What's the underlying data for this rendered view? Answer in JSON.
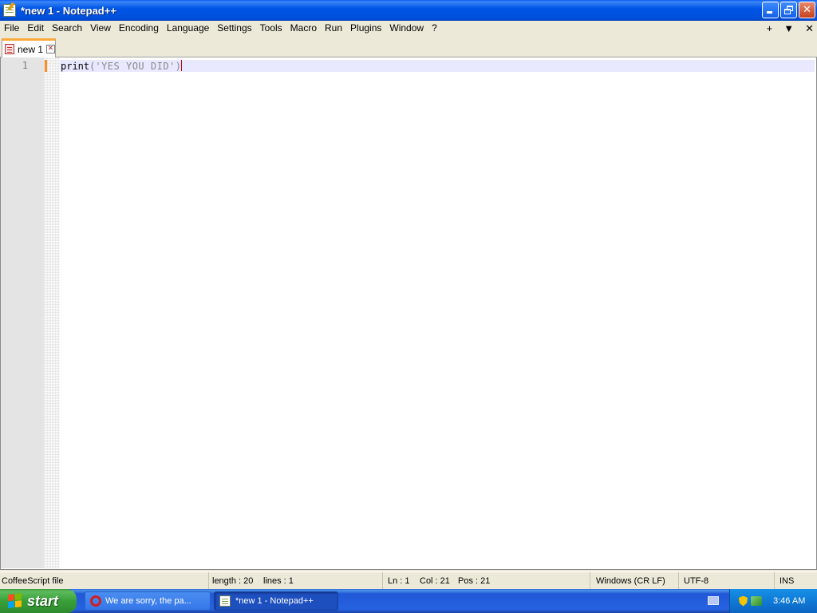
{
  "window": {
    "title": "*new 1 - Notepad++",
    "minimize_glyph": "_",
    "close_glyph": "✕"
  },
  "menu": {
    "items": [
      "File",
      "Edit",
      "Search",
      "View",
      "Encoding",
      "Language",
      "Settings",
      "Tools",
      "Macro",
      "Run",
      "Plugins",
      "Window",
      "?"
    ],
    "right": {
      "add": "+",
      "dropdown": "▼",
      "close": "✕"
    }
  },
  "tabs": [
    {
      "label": "new 1",
      "close": "✕",
      "modified": true
    }
  ],
  "editor": {
    "line_numbers": [
      "1"
    ],
    "code": {
      "fn": "print",
      "open": "(",
      "string": "'YES YOU DID'",
      "close": ")"
    }
  },
  "status": {
    "file_type": "CoffeeScript file",
    "length": "length : 20",
    "lines": "lines : 1",
    "ln": "Ln : 1",
    "col": "Col : 21",
    "pos": "Pos : 21",
    "eol": "Windows (CR LF)",
    "encoding": "UTF-8",
    "mode": "INS"
  },
  "taskbar": {
    "start_label": "start",
    "buttons": [
      {
        "label": "We are sorry, the pa...",
        "icon": "opera-icon",
        "active": false
      },
      {
        "label": "*new 1 - Notepad++",
        "icon": "notepad-icon",
        "active": true
      }
    ],
    "clock": "3:46 AM"
  },
  "colors": {
    "title_bar": "#0055E5",
    "tab_accent": "#FAAA3C",
    "current_line": "#E8E8FF",
    "change_marker": "#FF8C1A",
    "start_button": "#38A038"
  }
}
